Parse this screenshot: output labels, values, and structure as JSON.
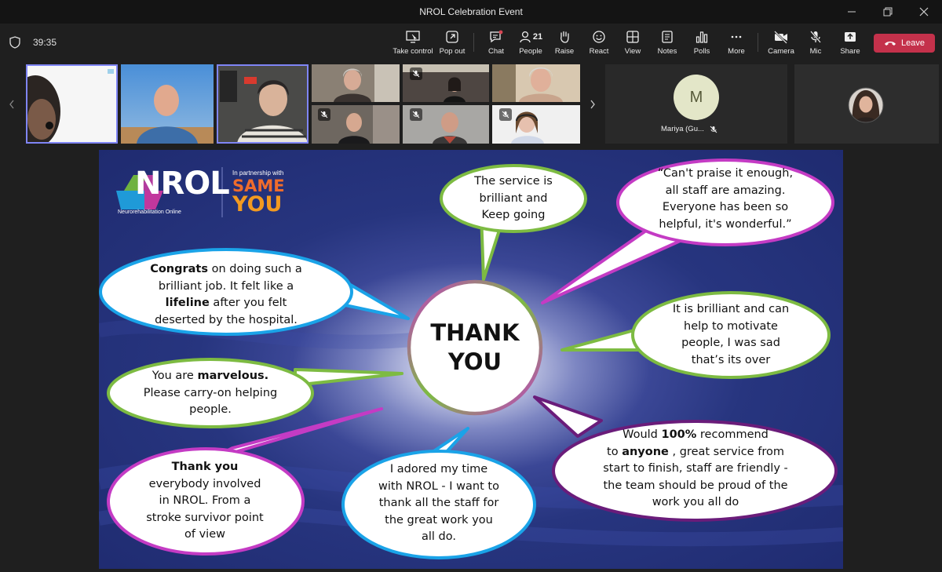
{
  "window": {
    "title": "NROL Celebration Event"
  },
  "meeting": {
    "timer": "39:35"
  },
  "toolbar": {
    "take_control": "Take control",
    "pop_out": "Pop out",
    "chat": "Chat",
    "people": "People",
    "people_count": "21",
    "raise": "Raise",
    "react": "React",
    "view": "View",
    "notes": "Notes",
    "polls": "Polls",
    "more": "More",
    "camera": "Camera",
    "mic": "Mic",
    "share": "Share",
    "leave": "Leave"
  },
  "participants": {
    "mariya": {
      "initial": "M",
      "name": "Mariya (Gu..."
    }
  },
  "slide": {
    "logo_main": "NROL",
    "logo_sub": "Neurorehabilitation Online",
    "partner_small": "In partnership with",
    "partner_line1": "SAME",
    "partner_line2": "YOU",
    "center_line1": "THANK",
    "center_line2": "YOU",
    "b1": {
      "l1": "The service is",
      "l2": "brilliant and",
      "l3": "Keep going"
    },
    "b2": {
      "l1": "“Can't praise it enough,",
      "l2": "all staff are amazing.",
      "l3": "Everyone has been so",
      "l4": "helpful, it's wonderful.”"
    },
    "b3": {
      "l1a": "Congrats",
      "l1b": " on doing such a",
      "l2": "brilliant job.  It felt like a",
      "l3a": "lifeline",
      "l3b": " after you felt",
      "l4": "deserted by the hospital."
    },
    "b4": {
      "l1": "It is brilliant and can",
      "l2": "help to motivate",
      "l3": "people, I was sad",
      "l4": "that’s its over"
    },
    "b5": {
      "l1a": "You are ",
      "l1b": "marvelous.",
      "l2": "Please carry-on helping",
      "l3": "people."
    },
    "b6": {
      "l1a": "Would ",
      "l1b": "100%",
      "l1c": " recommend",
      "l2a": "to ",
      "l2b": "anyone",
      "l2c": " , great service from",
      "l3": "start to finish, staff are friendly -",
      "l4": "the team should be proud of the",
      "l5": "work you all do"
    },
    "b7": {
      "l1": "Thank you",
      "l2": "everybody involved",
      "l3": "in NROL.  From a",
      "l4": "stroke survivor point",
      "l5": "of view"
    },
    "b8": {
      "l1": "I adored my time",
      "l2": "with NROL - I want to",
      "l3": "thank all the staff for",
      "l4": "the great work you",
      "l5": "all do."
    }
  },
  "colors": {
    "leave": "#c4314b",
    "selected_tile": "#7f85f5",
    "slide_bg": "#27357f",
    "bubble_blue": "#1aa3e8",
    "bubble_green": "#7dbb42",
    "bubble_magenta": "#c43bc4",
    "bubble_purple": "#6a1c7a"
  }
}
